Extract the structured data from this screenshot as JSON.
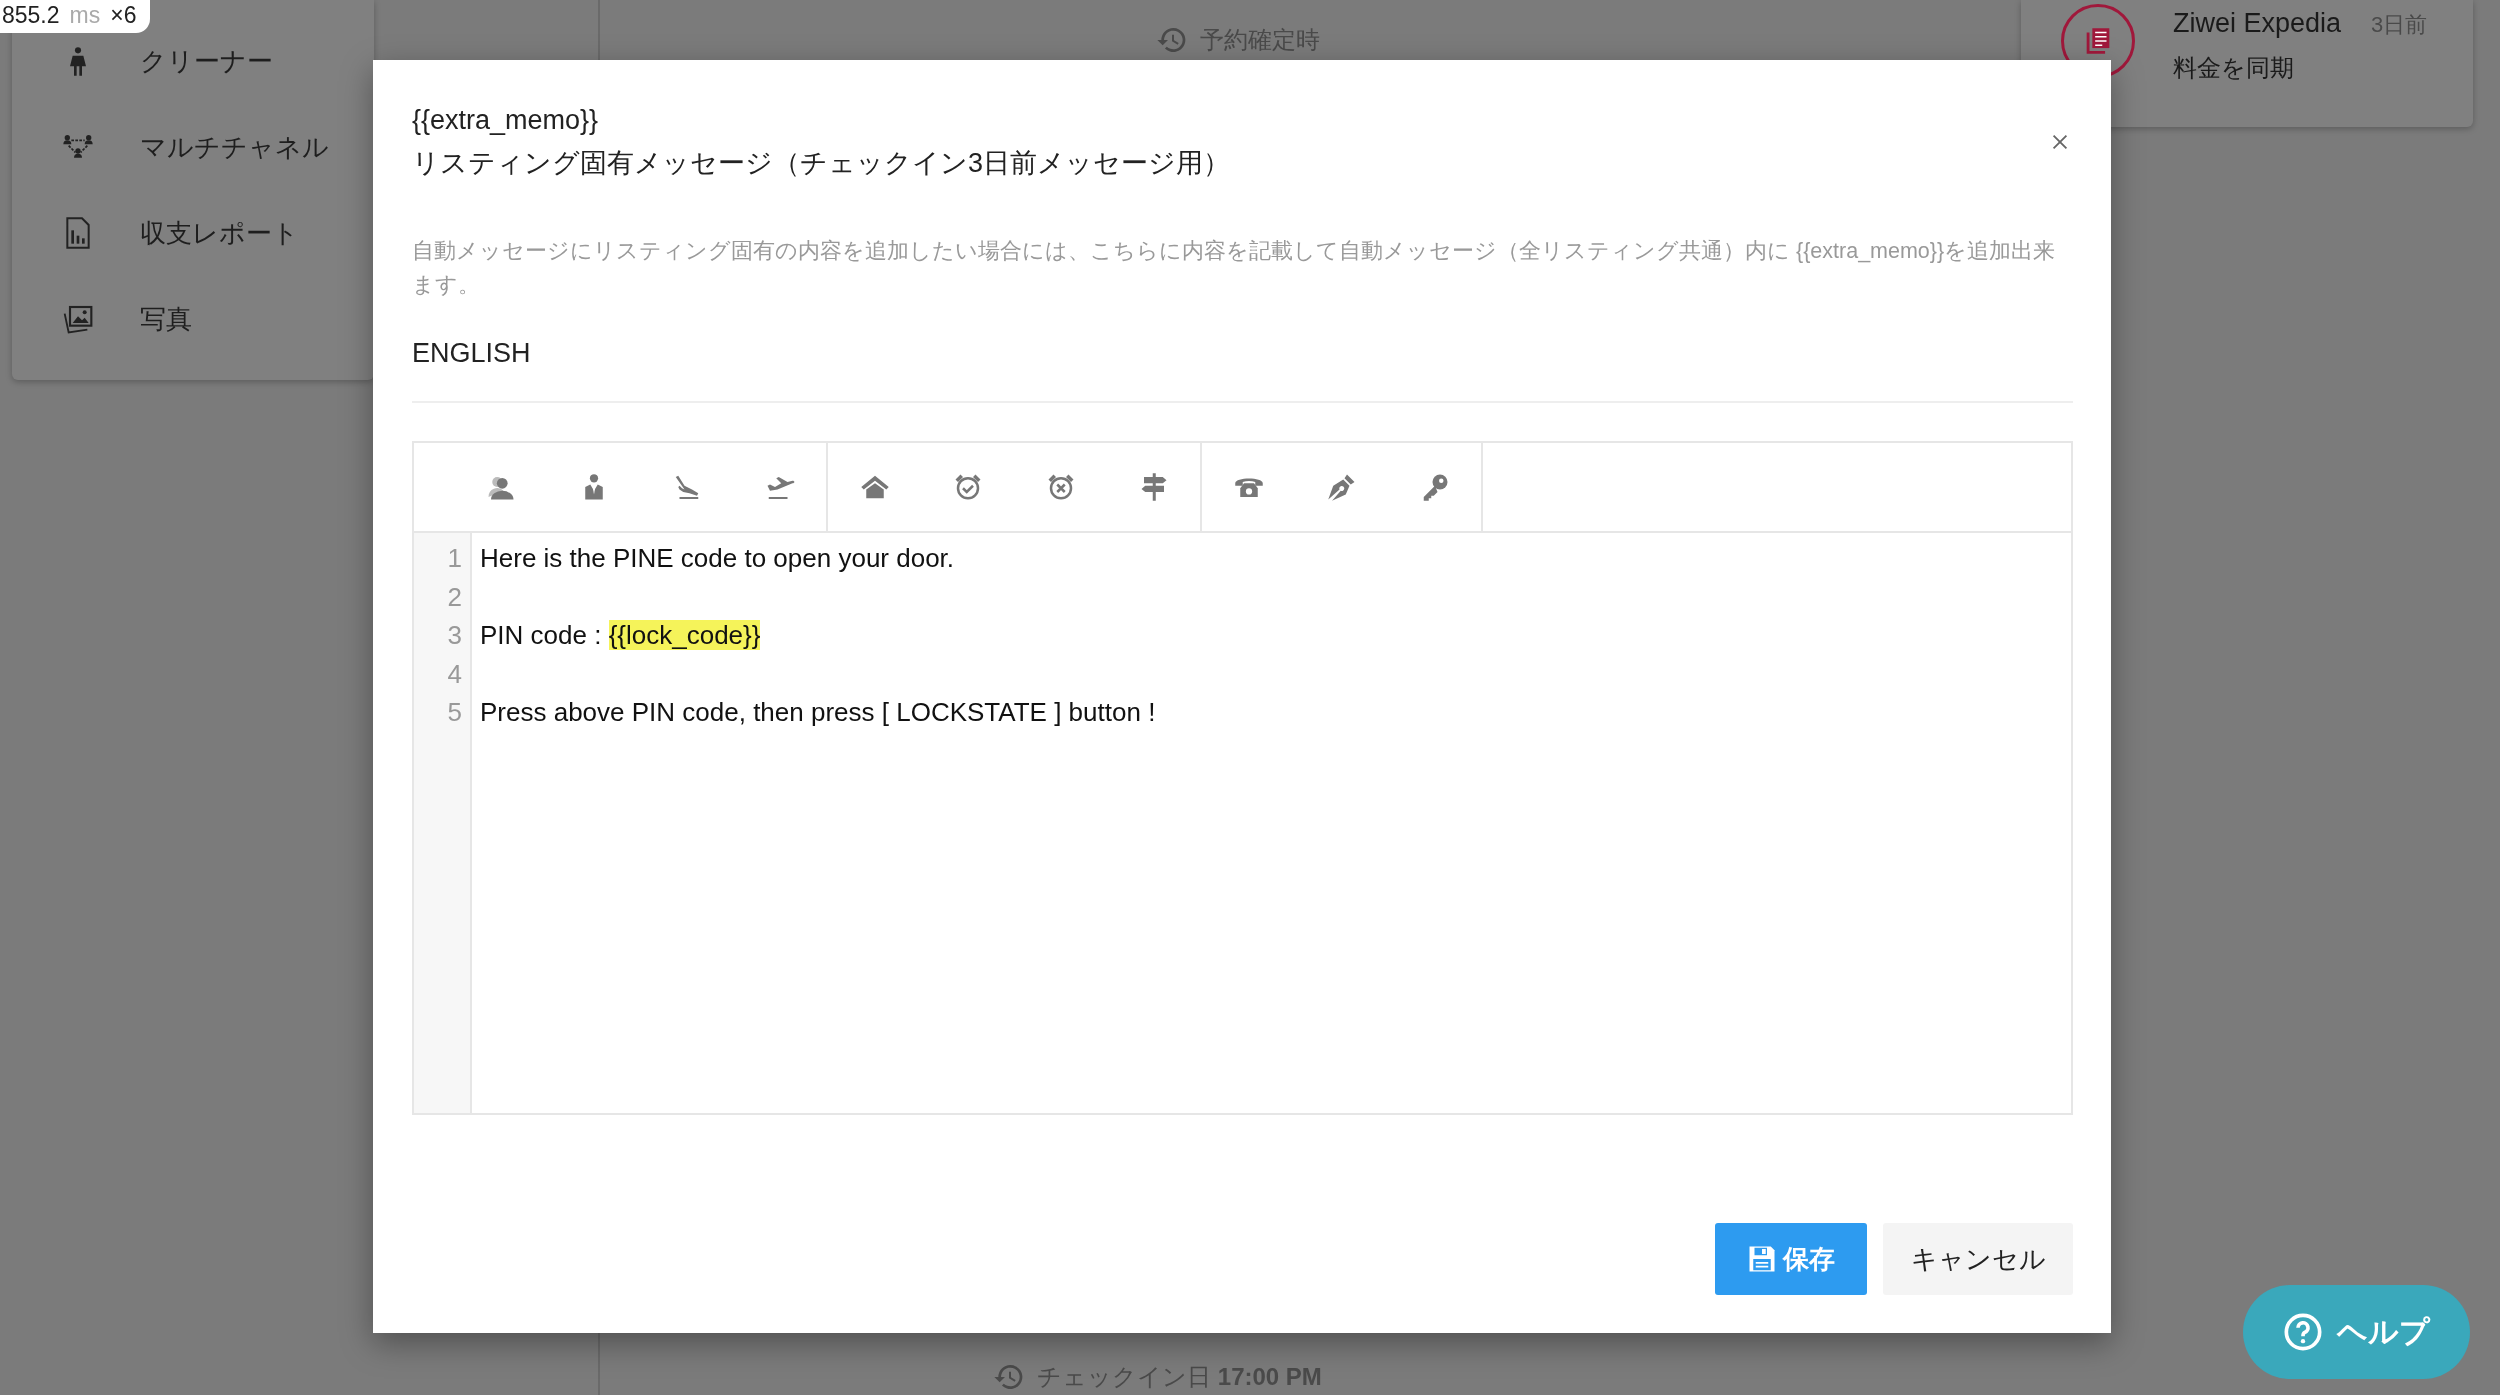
{
  "perf_badge": {
    "value": "855.2",
    "unit": "ms",
    "multiplier": "×6"
  },
  "sidebar": {
    "items": [
      {
        "label": "クリーナー"
      },
      {
        "label": "マルチチャネル"
      },
      {
        "label": "収支レポート"
      },
      {
        "label": "写真"
      }
    ]
  },
  "timeline": {
    "items": [
      {
        "label": "予約確定時"
      },
      {
        "label": "チェックイン日 **17:00 PM**"
      }
    ]
  },
  "notification": {
    "title": "Ziwei Expedia",
    "time": "3日前",
    "message": "料金を同期"
  },
  "dialog": {
    "title_lines": [
      "{{extra_memo}}",
      "リスティング固有メッセージ（チェックイン3日前メッセージ用）"
    ],
    "description": "自動メッセージにリスティング固有の内容を追加したい場合には、こちらに内容を記載して自動メッセージ（全リスティング共通）内に {{extra_memo}}を追加出来ます。",
    "language": "ENGLISH",
    "editor": {
      "lines": [
        {
          "number": "1",
          "segments": [
            {
              "text": "Here is the PINE code to open your door.",
              "highlighted": false
            }
          ]
        },
        {
          "number": "2"
        },
        {
          "number": "3",
          "segments": [
            {
              "text": "PIN code : ",
              "highlighted": false
            },
            {
              "text": "{{lock_code}}",
              "highlighted": true
            }
          ]
        },
        {
          "number": "4"
        },
        {
          "number": "5",
          "segments": [
            {
              "text": "Press above PIN code, then press [ LOCKSTATE ] button !",
              "highlighted": false
            }
          ]
        }
      ]
    },
    "buttons": {
      "save": "保存",
      "cancel": "キャンセル"
    }
  },
  "help_button": {
    "label": "ヘルプ"
  }
}
